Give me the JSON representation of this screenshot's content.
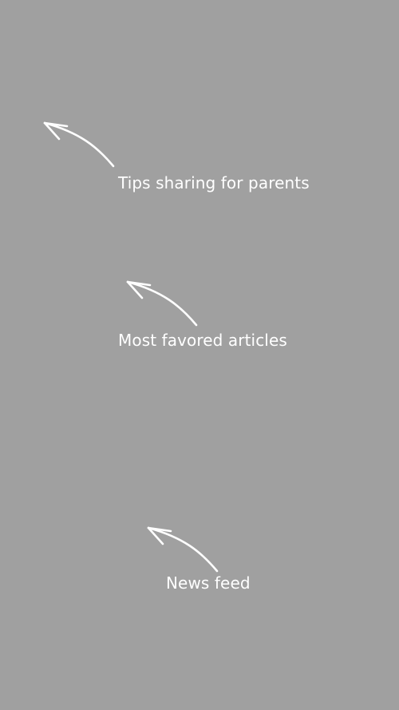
{
  "background_color": "#a0a0a0",
  "text_color": "#ffffff",
  "annotations": [
    {
      "icon": "curved-arrow-up-left-icon",
      "label": "Tips sharing for parents"
    },
    {
      "icon": "curved-arrow-up-left-icon",
      "label": "Most favored articles"
    },
    {
      "icon": "curved-arrow-up-left-icon",
      "label": "News feed"
    }
  ]
}
